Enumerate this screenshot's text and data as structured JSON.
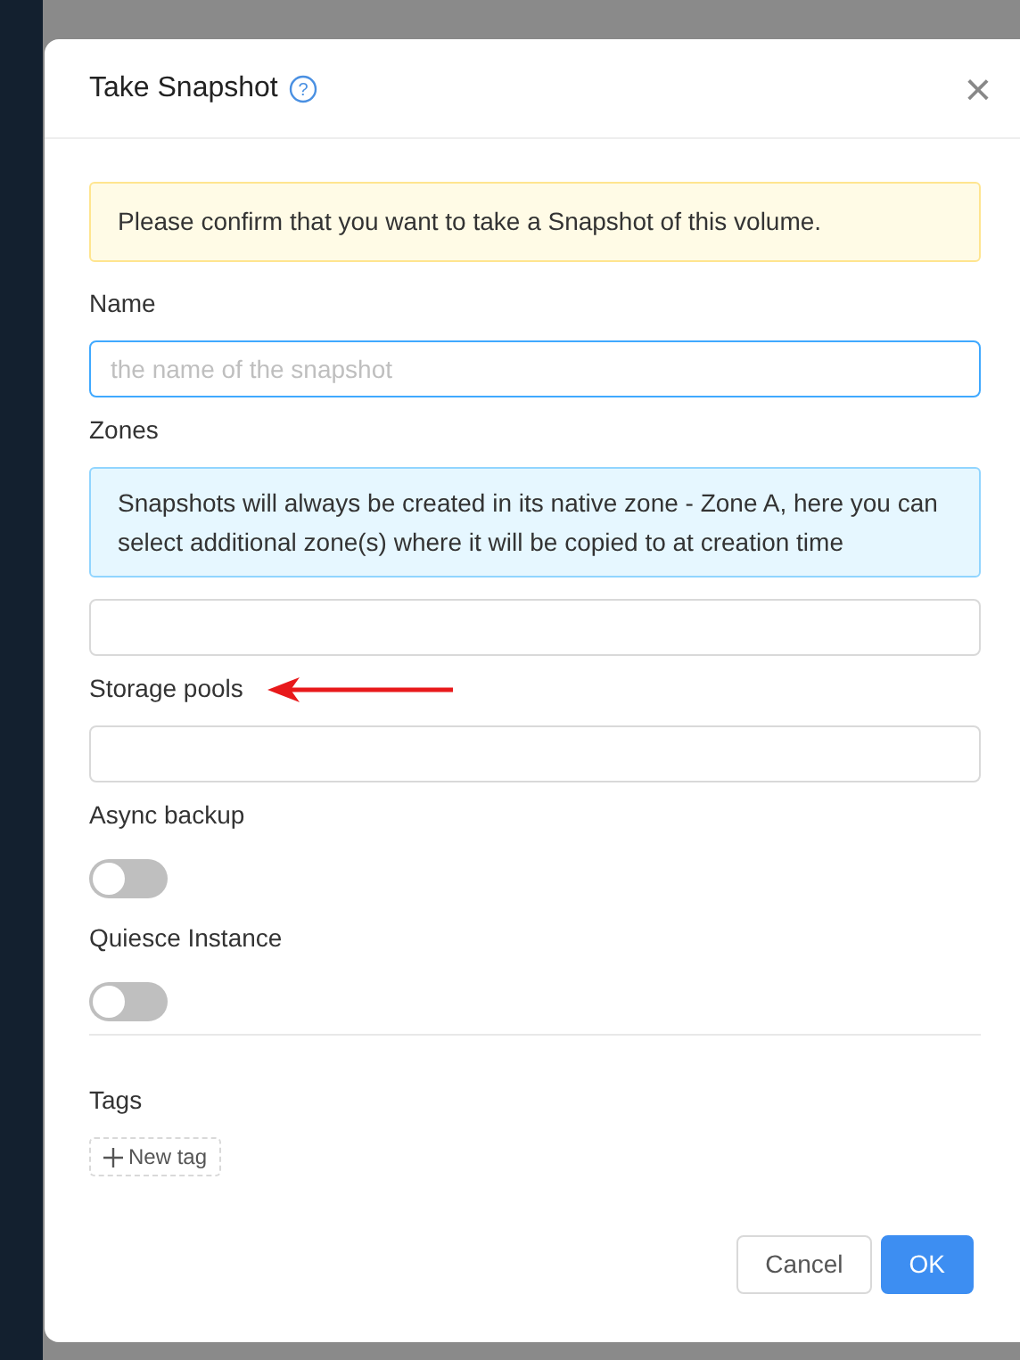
{
  "dialog": {
    "title": "Take Snapshot",
    "help_icon": "?",
    "close": "×"
  },
  "warning": "Please confirm that you want to take a Snapshot of this volume.",
  "fields": [
    {
      "kind": "text",
      "label": "Name",
      "placeholder": "the name of the snapshot"
    },
    {
      "kind": "info",
      "label": "Zones",
      "info": "Snapshots will always be created in its native zone - Zone A, here you can select additional zone(s) where it will be copied to at creation time"
    },
    {
      "kind": "select",
      "label": "Storage pools",
      "annotated": true
    },
    {
      "kind": "toggle",
      "label": "Async backup",
      "on": false
    },
    {
      "kind": "toggle",
      "label": "Quiesce Instance",
      "on": false
    }
  ],
  "tags": {
    "label": "Tags",
    "add": "New tag"
  },
  "buttons": [
    {
      "label": "Cancel",
      "kind": "secondary"
    },
    {
      "label": "OK",
      "kind": "primary"
    }
  ]
}
